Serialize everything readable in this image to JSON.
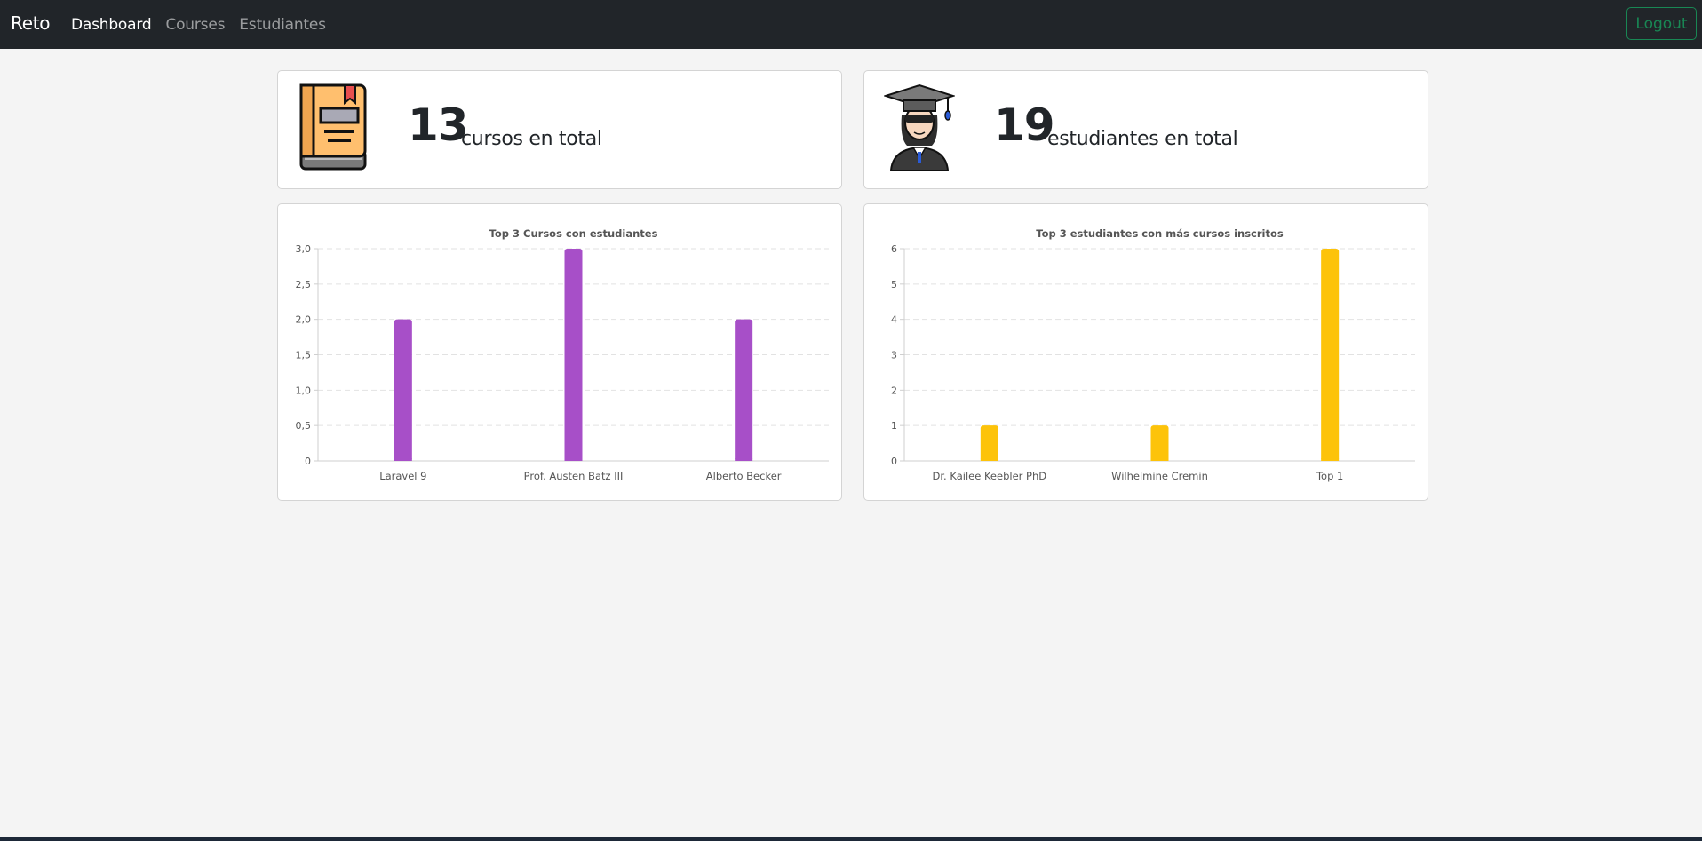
{
  "navbar": {
    "brand": "Reto",
    "links": [
      {
        "label": "Dashboard",
        "active": true
      },
      {
        "label": "Courses",
        "active": false
      },
      {
        "label": "Estudiantes",
        "active": false
      }
    ],
    "logout_label": "Logout"
  },
  "stats": {
    "courses": {
      "number": "13",
      "label": "cursos en total",
      "icon": "book-icon"
    },
    "students": {
      "number": "19",
      "label": "estudiantes en total",
      "icon": "graduate-student-icon"
    }
  },
  "colors": {
    "courses_bar": "#a74fc8",
    "students_bar": "#fdc30a",
    "logout": "#198754"
  },
  "chart_data": [
    {
      "type": "bar",
      "title": "Top 3 Cursos con estudiantes",
      "categories": [
        "Laravel 9",
        "Prof. Austen Batz III",
        "Alberto Becker"
      ],
      "values": [
        2,
        3,
        2
      ],
      "ylim": [
        0,
        3
      ],
      "yticks": [
        "0",
        "0,5",
        "1,0",
        "1,5",
        "2,0",
        "2,5",
        "3,0"
      ],
      "grid": true,
      "color": "#a74fc8"
    },
    {
      "type": "bar",
      "title": "Top 3 estudiantes con más cursos inscritos",
      "categories": [
        "Dr. Kailee Keebler PhD",
        "Wilhelmine Cremin",
        "Top 1"
      ],
      "values": [
        1,
        1,
        6
      ],
      "ylim": [
        0,
        6
      ],
      "yticks": [
        "0",
        "1",
        "2",
        "3",
        "4",
        "5",
        "6"
      ],
      "grid": true,
      "color": "#fdc30a"
    }
  ]
}
